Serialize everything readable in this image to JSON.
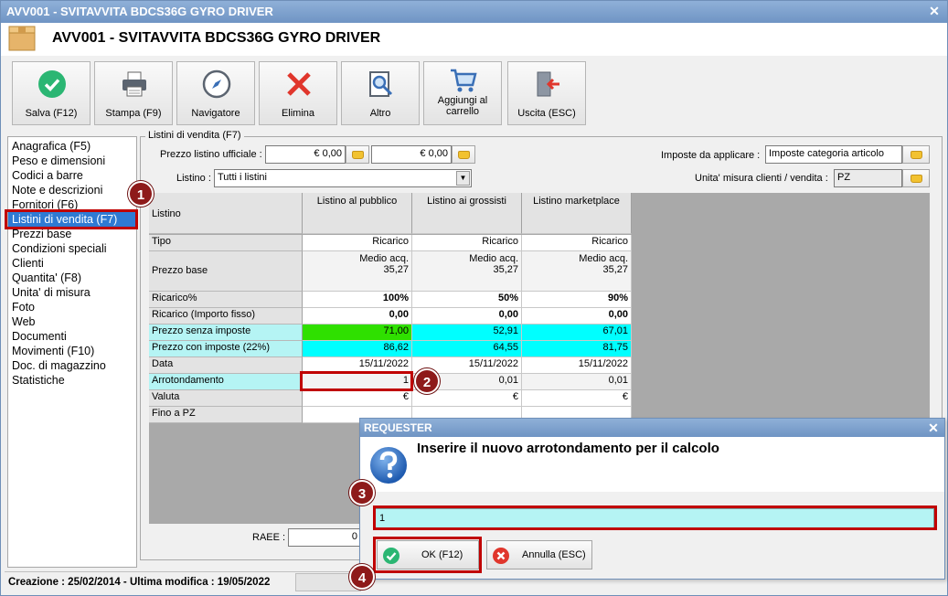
{
  "window": {
    "title_bar": "AVV001 - SVITAVVITA BDCS36G GYRO DRIVER",
    "title": "AVV001 - SVITAVVITA BDCS36G GYRO DRIVER"
  },
  "toolbar": {
    "save": "Salva (F12)",
    "print": "Stampa (F9)",
    "navigator": "Navigatore",
    "delete": "Elimina",
    "other": "Altro",
    "add_to_cart_line1": "Aggiungi al",
    "add_to_cart_line2": "carrello",
    "exit": "Uscita (ESC)"
  },
  "sidenav": {
    "items": [
      "Anagrafica (F5)",
      "Peso e dimensioni",
      "Codici a barre",
      "Note e descrizioni",
      "Fornitori (F6)",
      "Listini di vendita (F7)",
      "Prezzi base",
      "Condizioni speciali",
      "Clienti",
      "Quantita' (F8)",
      "Unita' di misura",
      "Foto",
      "Web",
      "Documenti",
      "Movimenti (F10)",
      "Doc. di magazzino",
      "Statistiche"
    ],
    "selected_index": 5
  },
  "price_lists": {
    "group_title": "Listini di vendita (F7)",
    "official_price_label": "Prezzo listino ufficiale :",
    "official_price_1": "€ 0,00",
    "official_price_2": "€ 0,00",
    "list_label": "Listino :",
    "list_value": "Tutti i listini",
    "taxes_label": "Imposte da applicare :",
    "taxes_value": "Imposte categoria articolo",
    "uom_label": "Unita' misura clienti / vendita :",
    "uom_value": "PZ",
    "raee_label": "RAEE :",
    "raee_value": "0"
  },
  "grid": {
    "corner": "Listino",
    "columns": [
      "Listino al pubblico",
      "Listino ai grossisti",
      "Listino marketplace"
    ],
    "rows": {
      "tipo": {
        "label": "Tipo",
        "values": [
          "Ricarico",
          "Ricarico",
          "Ricarico"
        ]
      },
      "prezzo_base": {
        "label": "Prezzo base",
        "line1": [
          "Medio acq.",
          "Medio acq.",
          "Medio acq."
        ],
        "line2": [
          "35,27",
          "35,27",
          "35,27"
        ]
      },
      "ricarico_pct": {
        "label": "Ricarico%",
        "values": [
          "100%",
          "50%",
          "90%"
        ]
      },
      "ricarico_fisso": {
        "label": "Ricarico (Importo fisso)",
        "values": [
          "0,00",
          "0,00",
          "0,00"
        ]
      },
      "senza_imposte": {
        "label": "Prezzo senza imposte",
        "values": [
          "71,00",
          "52,91",
          "67,01"
        ]
      },
      "con_imposte": {
        "label": "Prezzo con imposte (22%)",
        "values": [
          "86,62",
          "64,55",
          "81,75"
        ]
      },
      "data": {
        "label": "Data",
        "values": [
          "15/11/2022",
          "15/11/2022",
          "15/11/2022"
        ]
      },
      "arrotondamento": {
        "label": "Arrotondamento",
        "values": [
          "1",
          "0,01",
          "0,01"
        ]
      },
      "valuta": {
        "label": "Valuta",
        "values": [
          "€",
          "€",
          "€"
        ]
      },
      "fino_a": {
        "label": "Fino a PZ",
        "values": [
          "",
          "",
          ""
        ]
      }
    }
  },
  "status": {
    "text": "Creazione : 25/02/2014 - Ultima modifica : 19/05/2022"
  },
  "dialog": {
    "title": "REQUESTER",
    "message": "Inserire il nuovo arrotondamento per il calcolo",
    "input_value": "1",
    "ok": "OK (F12)",
    "cancel": "Annulla (ESC)"
  },
  "badges": [
    "1",
    "2",
    "3",
    "4"
  ],
  "colors": {
    "highlight": "#c00000",
    "selection": "#2f7ad3",
    "cyan": "#00ffff",
    "green": "#2fe000",
    "badge": "#8e1a1a"
  }
}
